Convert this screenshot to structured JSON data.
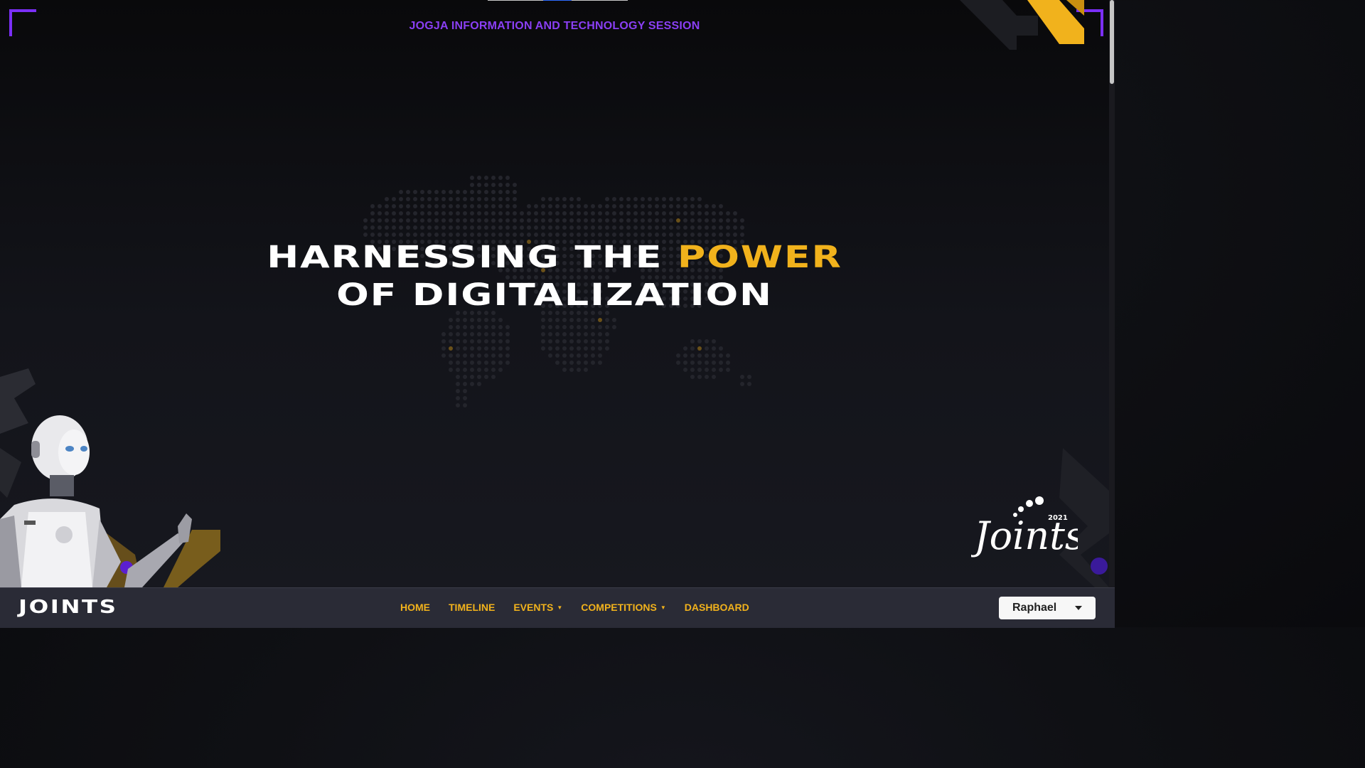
{
  "hero": {
    "subtitle": "JOGJA INFORMATION AND TECHNOLOGY SESSION",
    "headline_part1": "HARNESSING THE ",
    "headline_accent": "POWER",
    "headline_line2": "OF DIGITALIZATION"
  },
  "logo": {
    "year": "2021",
    "name": "Joints"
  },
  "navbar": {
    "brand": "JOINTS",
    "items": [
      {
        "label": "HOME"
      },
      {
        "label": "TIMELINE"
      },
      {
        "label": "EVENTS",
        "dropdown": true
      },
      {
        "label": "COMPETITIONS",
        "dropdown": true
      },
      {
        "label": "DASHBOARD"
      }
    ],
    "user": {
      "name": "Raphael"
    }
  },
  "colors": {
    "accent": "#f1b21c",
    "purple": "#7b2ff7",
    "navbar": "#2a2b36"
  },
  "icons": {
    "user_dropdown": "caret-down-icon",
    "nav_dropdown": "caret-down-icon"
  }
}
